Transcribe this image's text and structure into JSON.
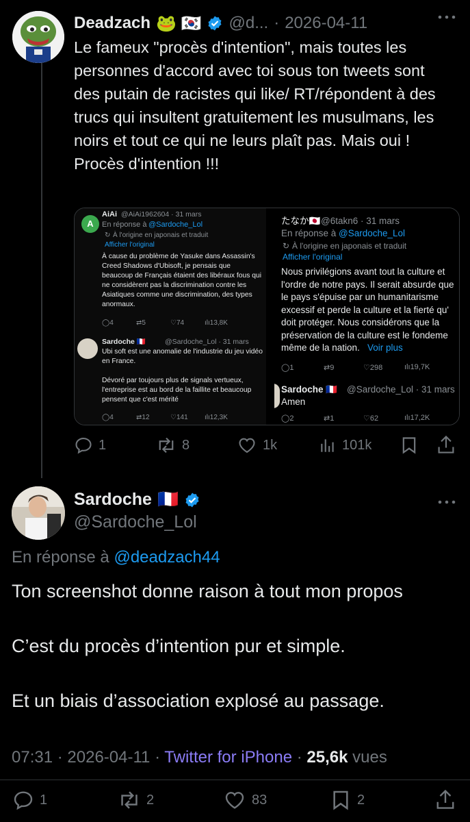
{
  "colors": {
    "background": "#000000",
    "text": "#e7e9ea",
    "secondary": "#71767b",
    "accent": "#1d9bf0",
    "verified": "#1d9bf0",
    "link_purple": "#8b7cf6"
  },
  "tweet1": {
    "name": "Deadzach",
    "name_emojis": "🐸 🇰🇷",
    "handle": "@d...",
    "separator": "·",
    "date": "2026-04-11",
    "text": "Le fameux \"procès d'intention\", mais toutes les personnes d'accord avec toi sous ton tweets sont des putain de racistes qui like/ RT/répondent à des trucs qui insultent gratuitement les musulmans, les noirs et tout ce qui ne leurs plaît pas. Mais oui ! Procès d'intention !!!",
    "media": {
      "left": {
        "post1": {
          "avatar_letter": "A",
          "name": "AiAi",
          "handle_date": "@AiAi1962604 · 31 mars",
          "reply_prefix": "En réponse à",
          "reply_to": "@Sardoche_Lol",
          "translated": "À l'origine en japonais et traduit",
          "show_original": "Afficher l'original",
          "text": "À cause du problème de Yasuke dans Assassin's Creed Shadows d'Ubisoft, je pensais que beaucoup de Français étaient des libéraux fous qui ne considèrent pas la discrimination contre les Asiatiques comme une discrimination, des types anormaux.",
          "replies": "4",
          "reposts": "5",
          "likes": "74",
          "views": "13,8K"
        },
        "post2": {
          "name": "Sardoche 🇫🇷",
          "handle_date": "@Sardoche_Lol · 31 mars",
          "text": "Ubi soft est une anomalie de l'industrie du jeu vidéo en France.\n\nDévoré par toujours plus de signals vertueux, l'entreprise est au bord de la faillite et beaucoup pensent que c'est mérité",
          "replies": "4",
          "reposts": "12",
          "likes": "141",
          "views": "12,3K"
        }
      },
      "right": {
        "post1": {
          "name": "たなか🇯🇵",
          "handle_date": "@6takn6 · 31 mars",
          "reply_prefix": "En réponse à",
          "reply_to": "@Sardoche_Lol",
          "translated": "À l'origine en japonais et traduit",
          "show_original": "Afficher l'original",
          "text": "Nous privilégions avant tout la culture et l'ordre de notre pays. Il serait absurde que le pays s'épuise par un humanitarisme excessif et perde la culture et la fierté qu' doit protéger. Nous considérons que la préservation de la culture est le fondeme même de la nation.",
          "voir_plus": "Voir plus",
          "replies": "1",
          "reposts": "9",
          "likes": "298",
          "views": "19,7K"
        },
        "post2": {
          "name": "Sardoche 🇫🇷",
          "handle_date": "@Sardoche_Lol · 31 mars",
          "text": "Amen",
          "replies": "2",
          "reposts": "1",
          "likes": "62",
          "views": "17,2K"
        }
      }
    },
    "actions": {
      "replies": "1",
      "reposts": "8",
      "likes": "1k",
      "views": "101k"
    }
  },
  "tweet2": {
    "name": "Sardoche",
    "name_emoji": "🇫🇷",
    "handle": "@Sardoche_Lol",
    "reply_prefix": "En réponse à",
    "reply_to": "@deadzach44",
    "para1": "Ton screenshot donne raison à tout mon propos",
    "para2": "C’est du procès d’intention pur et simple.",
    "para3": "Et un biais d’association explosé au passage.",
    "time": "07:31",
    "date": "2026-04-11",
    "source": "Twitter for iPhone",
    "views_count": "25,6k",
    "views_label": "vues",
    "actions": {
      "replies": "1",
      "reposts": "2",
      "likes": "83",
      "bookmarks": "2"
    }
  },
  "icons": [
    "more-icon",
    "verified-icon",
    "reply-icon",
    "repost-icon",
    "like-icon",
    "views-icon",
    "bookmark-icon",
    "share-icon",
    "translate-icon"
  ]
}
